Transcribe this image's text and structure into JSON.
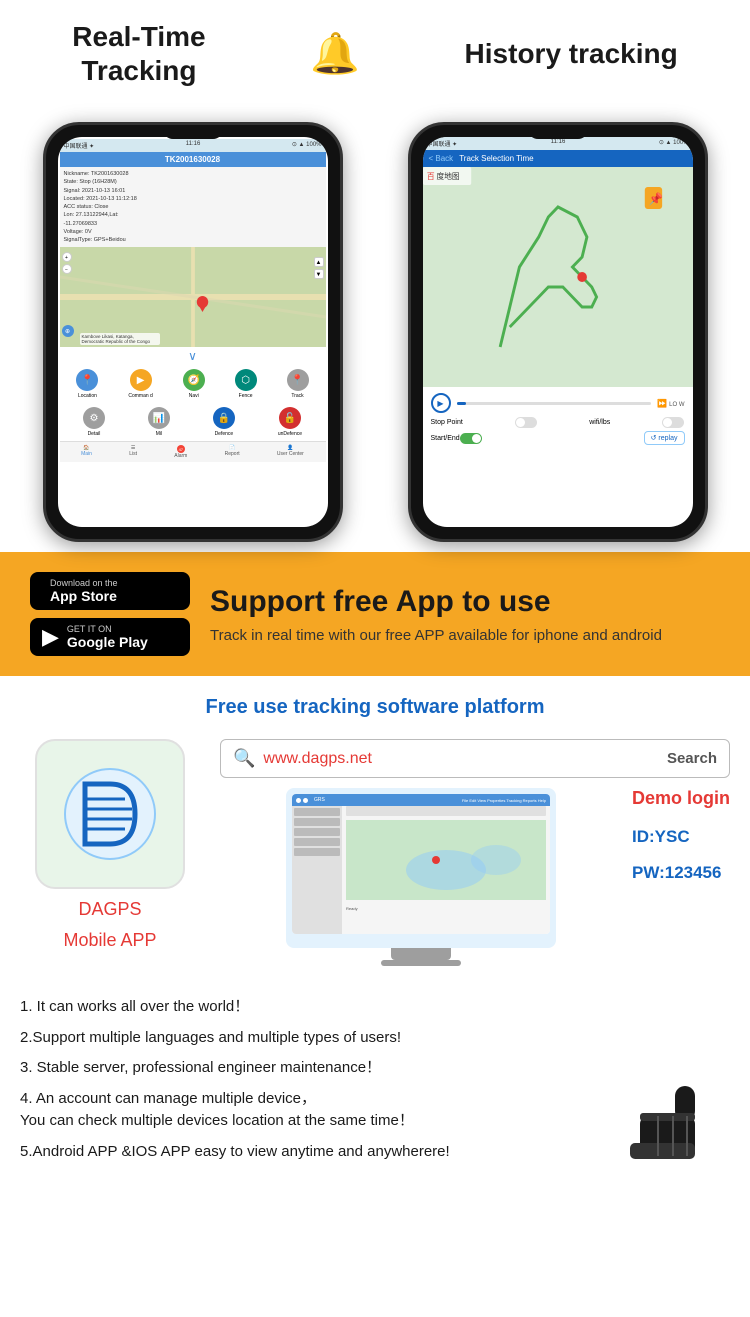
{
  "header": {
    "real_time_title": "Real-Time\nTracking",
    "bell_icon": "🔔",
    "history_title": "History tracking"
  },
  "left_phone": {
    "status_bar_left": "中国联通 ✦",
    "status_bar_time": "11:16",
    "status_bar_right": "⊙ ▲ 100%",
    "header_text": "TK2001630028",
    "info": {
      "nickname": "Nickname: TK2001630028",
      "state": "State: Stop (16H28M)",
      "signal": "Signal: 2021-10-13 16:01",
      "located": "Located: 2021-10-13 11:12:18",
      "acc": "ACC status: Close",
      "lon": "Lon: 27.13122944,Lat:",
      "lat": "-11.27069833",
      "voltage": "Voltage: 0V",
      "signal_type": "SignalType: GPS+Beidou"
    },
    "location_label": "Kambove Likasi, Katanga, Democratic Republic of the Congo",
    "nav_items": [
      {
        "icon": "📍",
        "label": "Location",
        "color": "blue"
      },
      {
        "icon": "📋",
        "label": "Command",
        "color": "orange"
      },
      {
        "icon": "🧭",
        "label": "Navi",
        "color": "green"
      },
      {
        "icon": "🔷",
        "label": "Fence",
        "color": "teal"
      },
      {
        "icon": "📍",
        "label": "Track",
        "color": "gray"
      }
    ],
    "nav_items2": [
      {
        "icon": "⚙️",
        "label": "Detail",
        "color": "gray"
      },
      {
        "icon": "📊",
        "label": "Mil",
        "color": "gray"
      },
      {
        "icon": "🔒",
        "label": "Defence",
        "color": "dark-blue"
      },
      {
        "icon": "🔓",
        "label": "unDefence",
        "color": "red"
      }
    ],
    "bottom_bar": [
      {
        "label": "Main",
        "active": true
      },
      {
        "label": "List",
        "active": false
      },
      {
        "label": "Alarm",
        "active": false,
        "badge": "47"
      },
      {
        "label": "Report",
        "active": false
      },
      {
        "label": "User Center",
        "active": false
      }
    ]
  },
  "right_phone": {
    "status_bar_left": "中国联通 ✦",
    "status_bar_time": "11:16",
    "status_bar_right": "⊙ ▲ 100%",
    "back_label": "< Back",
    "header_text": "Track Selection Time",
    "stop_point_label": "Stop Point",
    "wifi_lbs_label": "wifi/lbs",
    "start_end_label": "Start/End",
    "replay_label": "↺ replay",
    "speed_label": "LO\nW"
  },
  "app_store": {
    "main_text": "Support free App to use",
    "sub_text": "Track in real time with our free APP available for iphone and android",
    "ios_small": "Download on the",
    "ios_large": "App Store",
    "android_small": "GET IT ON",
    "android_large": "Google Play"
  },
  "platform": {
    "title": "Free use tracking software platform",
    "search_url": "www.dagps.net",
    "search_placeholder": "Search",
    "search_btn": "Search",
    "app_logo_text": "DAGPS",
    "mobile_app_label": "Mobile APP",
    "demo_title": "Demo login",
    "demo_id": "ID:YSC",
    "demo_pw": "PW:123456"
  },
  "features": {
    "items": [
      "1. It can works all over the world！",
      "2.Support multiple languages and multiple types of users!",
      "3. Stable server, professional engineer maintenance！",
      "4. An account can manage multiple device，\nYou can check multiple devices location at the same time！",
      "5.Android APP &IOS APP easy to view anytime and anywherere!"
    ]
  }
}
